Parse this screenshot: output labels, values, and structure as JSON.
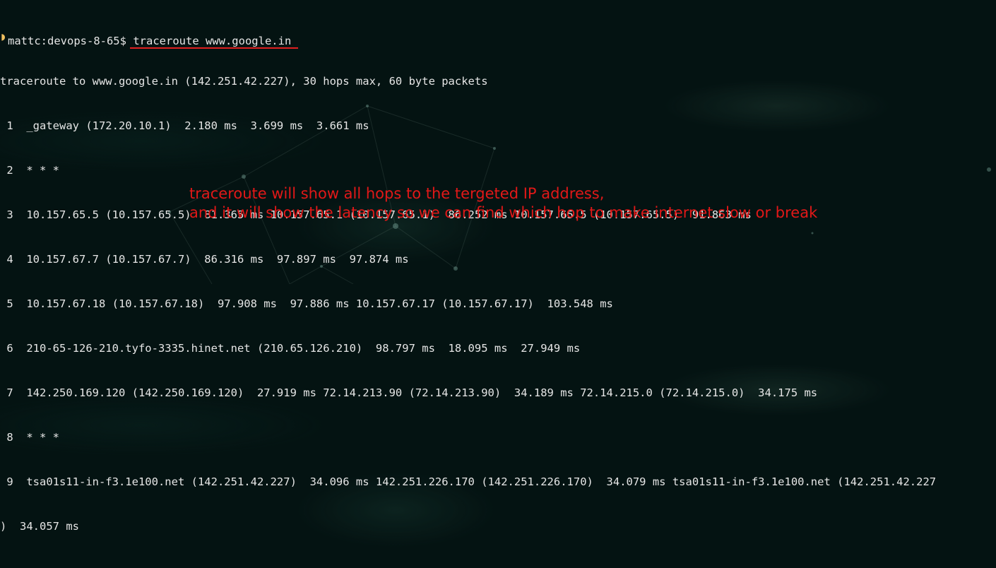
{
  "prompt": {
    "user_host": "mattc:devops-8-65$",
    "moon_icon": "moon-icon"
  },
  "command": "traceroute www.google.in",
  "output_lines": [
    "traceroute to www.google.in (142.251.42.227), 30 hops max, 60 byte packets",
    " 1  _gateway (172.20.10.1)  2.180 ms  3.699 ms  3.661 ms",
    " 2  * * *",
    " 3  10.157.65.5 (10.157.65.5)  81.365 ms 10.157.65.1 (10.157.65.1)  86.252 ms 10.157.65.5 (10.157.65.5)  91.863 ms",
    " 4  10.157.67.7 (10.157.67.7)  86.316 ms  97.897 ms  97.874 ms",
    " 5  10.157.67.18 (10.157.67.18)  97.908 ms  97.886 ms 10.157.67.17 (10.157.67.17)  103.548 ms",
    " 6  210-65-126-210.tyfo-3335.hinet.net (210.65.126.210)  98.797 ms  18.095 ms  27.949 ms",
    " 7  142.250.169.120 (142.250.169.120)  27.919 ms 72.14.213.90 (72.14.213.90)  34.189 ms 72.14.215.0 (72.14.215.0)  34.175 ms",
    " 8  * * *",
    " 9  tsa01s11-in-f3.1e100.net (142.251.42.227)  34.096 ms 142.251.226.170 (142.251.226.170)  34.079 ms tsa01s11-in-f3.1e100.net (142.251.42.227",
    ")  34.057 ms"
  ],
  "annotation": {
    "line1": "traceroute will show all hops to the tergeted IP address,",
    "line2": "and it will show the latency so we can find which hop to make internet slow or break",
    "color": "#e21818"
  },
  "colors": {
    "background": "#041312",
    "text": "#e6e6e6",
    "underline": "#e02020"
  }
}
